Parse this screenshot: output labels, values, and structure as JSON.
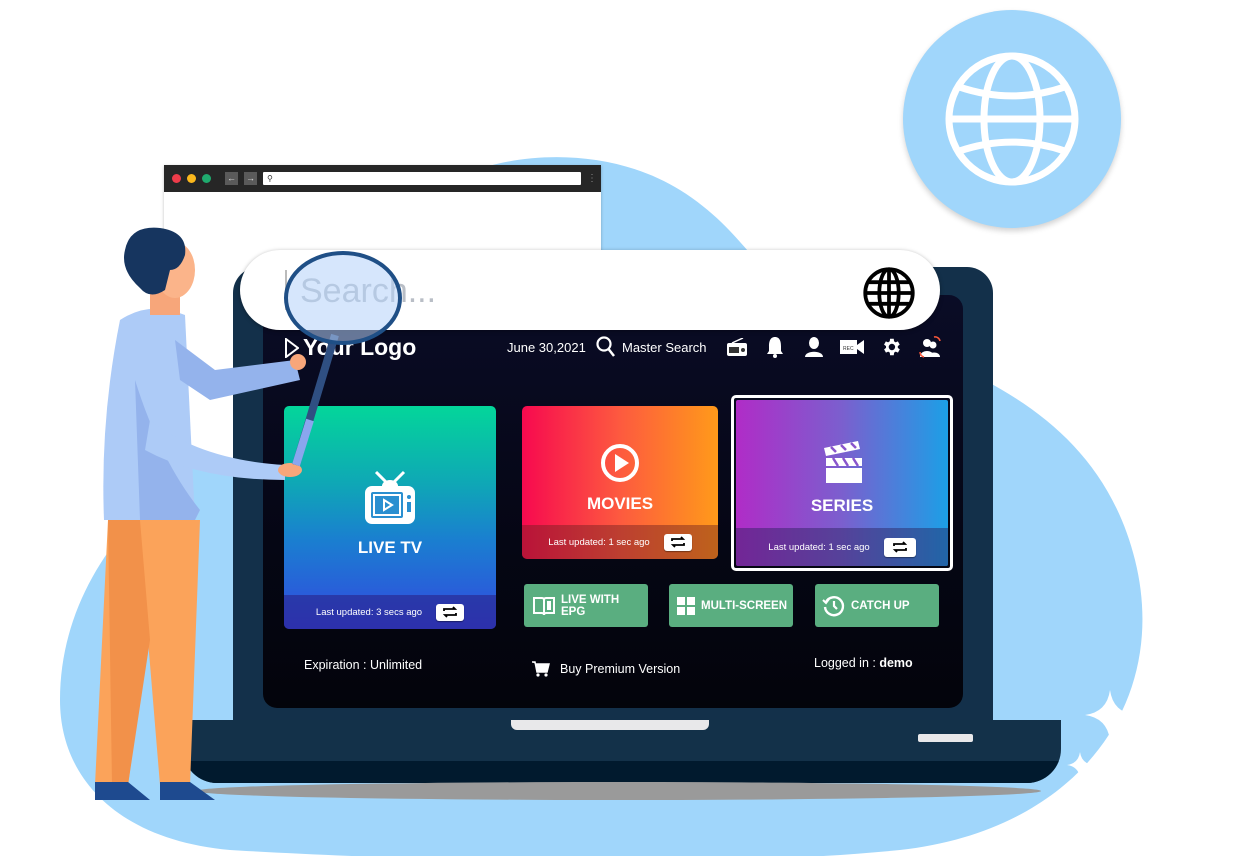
{
  "search": {
    "placeholder": "Search..."
  },
  "mini_browser": {
    "traffic_lights": [
      "#ee3c4a",
      "#fbb81d",
      "#1faa6e"
    ],
    "back_icon": "←",
    "forward_icon": "→",
    "search_icon": "⚲"
  },
  "header": {
    "logo": "Your Logo",
    "date": "June 30,2021",
    "master_search": "Master Search",
    "icons": [
      "radio-icon",
      "bell-icon",
      "user-icon",
      "record-camera-icon",
      "gear-icon",
      "switch-user-icon"
    ]
  },
  "tiles": {
    "live_tv": {
      "label": "LIVE TV",
      "status": "Last updated: 3 secs ago"
    },
    "movies": {
      "label": "MOVIES",
      "status": "Last updated: 1 sec ago"
    },
    "series": {
      "label": "SERIES",
      "status": "Last updated: 1 sec ago"
    }
  },
  "quick_buttons": {
    "live_epg": {
      "line1": "LIVE WITH",
      "line2": "EPG"
    },
    "multi_screen": "MULTI-SCREEN",
    "catch_up": "CATCH UP"
  },
  "footer": {
    "expiration_label": "Expiration : ",
    "expiration_value": "Unlimited",
    "buy_premium": "Buy Premium Version",
    "logged_in_label": "Logged in : ",
    "logged_in_user": "demo"
  },
  "colors": {
    "background_blob": "#a0d6fb",
    "screen_bg": "#06081a",
    "laptop_body": "#13304a",
    "quick_button": "#5aae80",
    "live_tv_gradient": [
      "#03d69a",
      "#3348e0"
    ],
    "movies_gradient": [
      "#f7094f",
      "#ff9a1a"
    ],
    "series_gradient": [
      "#b02cc7",
      "#1c9fe6"
    ]
  }
}
